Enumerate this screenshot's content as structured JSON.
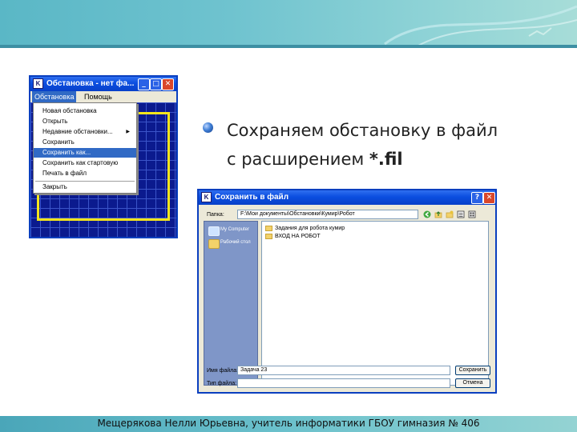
{
  "slide": {
    "text_line1": "Сохраняем обстановку в файл",
    "text_line2_prefix": "с расширением ",
    "text_line2_bold": "*.fil",
    "footer": "Мещерякова Нелли Юрьевна, учитель информатики ГБОУ гимназия № 406"
  },
  "env_window": {
    "title": "Обстановка - нет фа...",
    "icon_letter": "K",
    "min_glyph": "_",
    "max_glyph": "□",
    "close_glyph": "✕",
    "menu": [
      "Обстановка",
      "Помощь"
    ],
    "dropdown": {
      "items": [
        {
          "label": "Новая обстановка"
        },
        {
          "label": "Открыть"
        },
        {
          "label": "Недавние обстановки...",
          "submenu": true
        },
        {
          "label": "Сохранить"
        },
        {
          "label": "Сохранить как...",
          "highlighted": true
        },
        {
          "label": "Сохранить как стартовую"
        },
        {
          "label": "Печать в файл"
        },
        {
          "label": "Закрыть"
        }
      ],
      "submenu_arrow": "▶"
    }
  },
  "save_dialog": {
    "title": "Сохранить в файл",
    "icon_letter": "K",
    "help_glyph": "?",
    "close_glyph": "✕",
    "folder_label": "Папка:",
    "folder_path": "F:\\Мои документы\\Обстановки\\Кумир\\Робот",
    "places": [
      "My Computer",
      "Рабочий стол"
    ],
    "files": [
      "Задания для робота кумир",
      "ВХОД НА РОБОТ"
    ],
    "filename_label": "Имя файла:",
    "filename_value": "Задача 23",
    "filetype_label": "Тип файла:",
    "filetype_value": "",
    "save_button": "Сохранить",
    "cancel_button": "Отмена"
  },
  "colors": {
    "accent_banner": "#6fc3cf",
    "xp_title": "#0b4ee0",
    "grid_bg": "#0b1a8e",
    "robot_wall": "#f5e51c",
    "menu_highlight": "#316ac5"
  }
}
